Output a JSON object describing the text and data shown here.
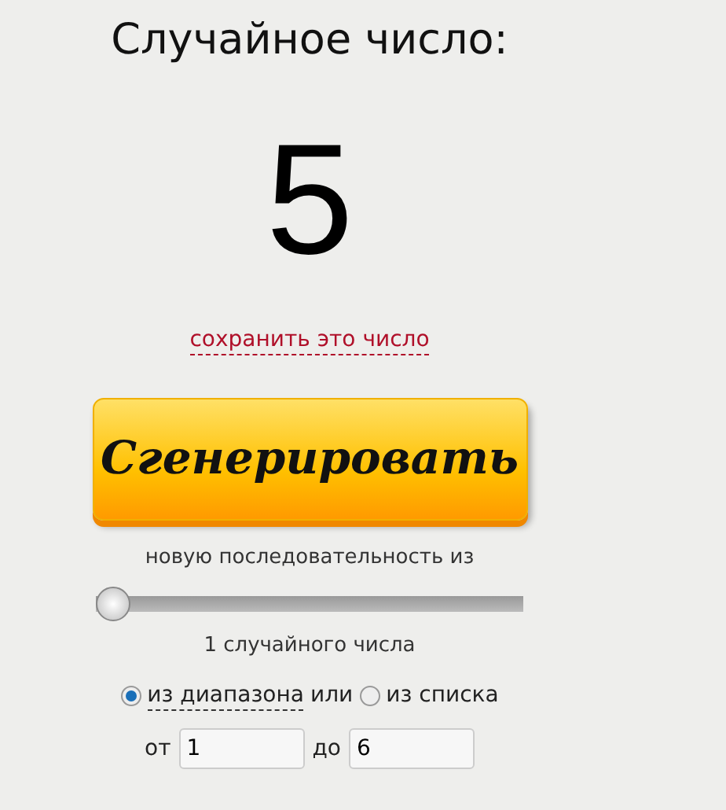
{
  "title": "Случайное число:",
  "result": "5",
  "save_link": "сохранить это число",
  "generate_button": "Сгенерировать",
  "sequence_label": "новую последовательность из",
  "count_slider": {
    "level": 0
  },
  "count_label": "1 случайного числа",
  "source_options": [
    {
      "label": "из диапазона",
      "selected": true
    },
    {
      "label": "из списка",
      "selected": false
    }
  ],
  "options_joiner": "или",
  "range": {
    "from_label": "от",
    "from_value": "1",
    "to_label": "до",
    "to_value": "6"
  }
}
